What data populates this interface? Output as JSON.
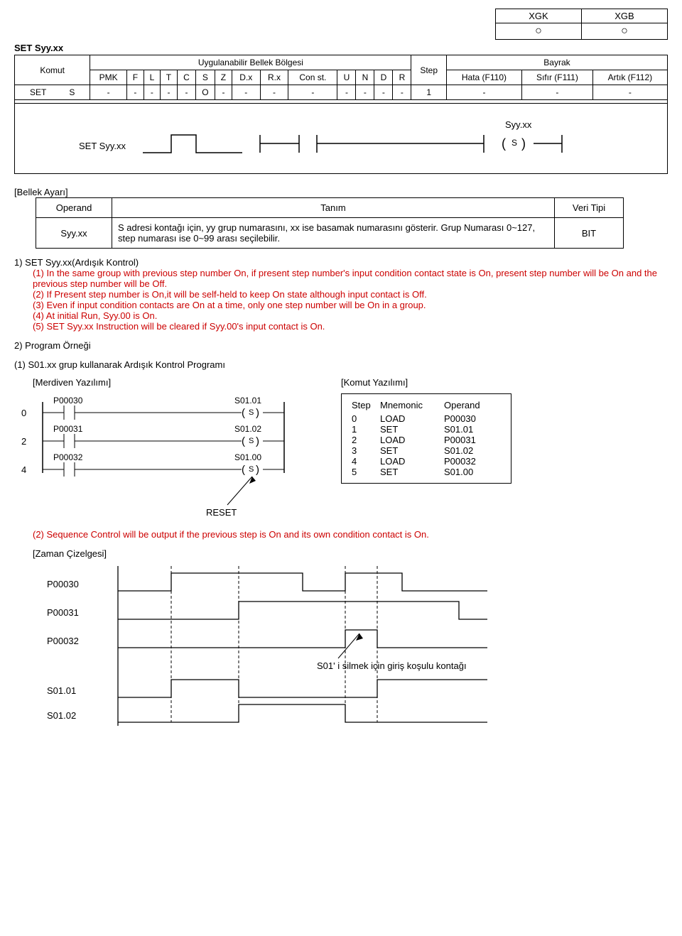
{
  "topbox": {
    "col1": "XGK",
    "col2": "XGB",
    "circle": "○"
  },
  "title": "SET Syy.xx",
  "table": {
    "komut": "Komut",
    "region": "Uygulanabilir Bellek Bölgesi",
    "bayrak": "Bayrak",
    "cols": [
      "PMK",
      "F",
      "L",
      "T",
      "C",
      "S",
      "Z",
      "D.x",
      "R.x",
      "Con st.",
      "U",
      "N",
      "D",
      "R",
      "Step",
      "Hata (F110)",
      "Sıfır (F111)",
      "Artık (F112)"
    ],
    "row_name": "SET",
    "row_sym": "S",
    "cells": [
      "-",
      "-",
      "-",
      "-",
      "-",
      "O",
      "-",
      "-",
      "-",
      "-",
      "-",
      "-",
      "-",
      "-",
      "1",
      "-",
      "-",
      "-"
    ]
  },
  "diagram": {
    "left_label": "SET Syy.xx",
    "right_label_top": "Syy.xx",
    "right_label_sym": "S"
  },
  "memset": {
    "title": "[Bellek Ayarı]",
    "h_operand": "Operand",
    "h_tanim": "Tanım",
    "h_tipi": "Veri Tipi",
    "operand": "Syy.xx",
    "desc": "S adresi kontağı için, yy grup numarasını, xx ise basamak numarasını gösterir. Grup Numarası 0~127, step numarası ise 0~99 arası seçilebilir.",
    "tipi": "BIT"
  },
  "sec1": {
    "title": "1) SET Syy.xx(Ardışık Kontrol)",
    "p1": "(1) In the same group with previous step number On, if present step number's input condition contact state is On, present step number will be On and the previous step number will be Off.",
    "p2": "(2) If Present step number is On,it will be self-held to keep On state although input contact is Off.",
    "p3": "(3) Even if input condition contacts are On at a time, only one step number will be On in a group.",
    "p4": "(4) At initial Run, Syy.00 is On.",
    "p5": "(5) SET Syy.xx Instruction will be cleared if Syy.00's input contact is On."
  },
  "sec2": {
    "title": "2) Program Örneği"
  },
  "prog": {
    "title": "(1) S01.xx grup kullanarak Ardışık Kontrol Programı",
    "merdiven": "[Merdiven Yazılımı]",
    "komut": "[Komut Yazılımı]",
    "ladder": [
      {
        "step": "0",
        "in": "P00030",
        "out": "S01.01"
      },
      {
        "step": "2",
        "in": "P00031",
        "out": "S01.02"
      },
      {
        "step": "4",
        "in": "P00032",
        "out": "S01.00"
      }
    ],
    "reset": "RESET",
    "mnemonic_head": {
      "step": "Step",
      "mn": "Mnemonic",
      "op": "Operand"
    },
    "mnemonic": [
      {
        "s": "0",
        "m": "LOAD",
        "o": "P00030"
      },
      {
        "s": "1",
        "m": "SET",
        "o": "S01.01"
      },
      {
        "s": "2",
        "m": "LOAD",
        "o": "P00031"
      },
      {
        "s": "3",
        "m": "SET",
        "o": "S01.02"
      },
      {
        "s": "4",
        "m": "LOAD",
        "o": "P00032"
      },
      {
        "s": "5",
        "m": "SET",
        "o": "S01.00"
      }
    ],
    "note2": "(2) Sequence Control will be output if the previous step is On and its own condition contact is On."
  },
  "timing": {
    "title": "[Zaman Çizelgesi]",
    "labels": [
      "P00030",
      "P00031",
      "P00032",
      "S01.01",
      "S01.02"
    ],
    "note": "S01' i silmek için giriş koşulu kontağı"
  }
}
